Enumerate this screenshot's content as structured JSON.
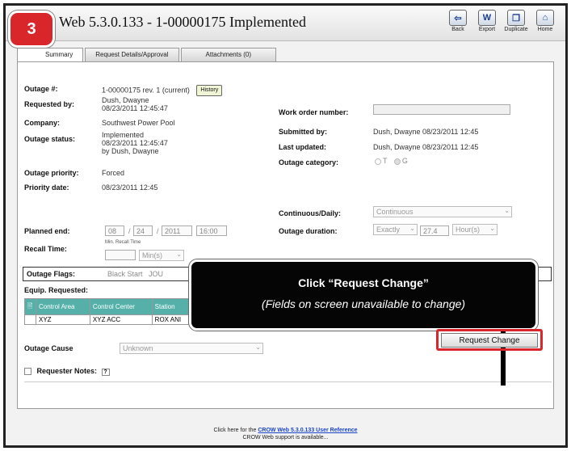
{
  "step_number": "3",
  "app_title": "Web 5.3.0.133 - 1-00000175 Implemented",
  "toolbar": [
    {
      "label": "Back",
      "icon": "back-arrow-icon",
      "glyph": "⇦"
    },
    {
      "label": "Export",
      "icon": "word-document-icon",
      "glyph": "W"
    },
    {
      "label": "Duplicate",
      "icon": "duplicate-icon",
      "glyph": "❐"
    },
    {
      "label": "Home",
      "icon": "home-icon",
      "glyph": "⌂"
    }
  ],
  "tabs": [
    "Summary",
    "Request Details/Approval",
    "Attachments (0)"
  ],
  "form": {
    "outage_num_label": "Outage #:",
    "outage_num_value": "1-00000175 rev. 1 (current)",
    "history_button": "History",
    "requested_by_label": "Requested by:",
    "requested_by_name": "Dush, Dwayne",
    "requested_by_date": "08/23/2011 12:45:47",
    "company_label": "Company:",
    "company_value": "Southwest Power Pool",
    "outage_status_label": "Outage status:",
    "outage_status_line1": "Implemented",
    "outage_status_line2": "08/23/2011 12:45:47",
    "outage_status_line3": "by Dush, Dwayne",
    "outage_priority_label": "Outage priority:",
    "outage_priority_value": "Forced",
    "priority_date_label": "Priority date:",
    "priority_date_value": "08/23/2011 12:45",
    "work_order_label": "Work order number:",
    "submitted_by_label": "Submitted by:",
    "submitted_by_value": "Dush, Dwayne 08/23/2011 12:45",
    "last_updated_label": "Last updated:",
    "last_updated_value": "Dush, Dwayne 08/23/2011 12:45",
    "outage_category_label": "Outage category:",
    "category_options": [
      "T",
      "G"
    ],
    "continuous_label": "Continuous/Daily:",
    "continuous_value": "Continuous",
    "planned_end_label": "Planned end:",
    "planned_end_month": "08",
    "planned_end_day": "24",
    "planned_end_year": "2011",
    "planned_end_time": "16:00",
    "outage_duration_label": "Outage duration:",
    "duration_mode": "Exactly",
    "duration_value": "27.4",
    "duration_unit": "Hour(s)",
    "recall_time_label": "Recall Time:",
    "min_recall_label": "Min. Recall Time",
    "recall_unit": "Min(s)",
    "outage_flags_label": "Outage Flags:",
    "outage_flags_value": "Black Start   JOU",
    "equip_requested_label": "Equip. Requested:",
    "equip_headers": [
      "Control Area",
      "Control Center",
      "Station"
    ],
    "equip_rows": [
      [
        "XYZ",
        "XYZ ACC",
        "ROX ANI"
      ]
    ],
    "outage_cause_label": "Outage Cause",
    "outage_cause_value": "Unknown",
    "requester_notes_label": "Requester Notes:"
  },
  "request_change_button": "Request Change",
  "callout": {
    "heading": "Click “Request Change”",
    "subtext": "(Fields on screen unavailable to change)"
  },
  "footer": {
    "prefix": "Click here for the",
    "link": "CROW Web 5.3.0.133 User Reference",
    "line2": "CROW Web support is available..."
  }
}
